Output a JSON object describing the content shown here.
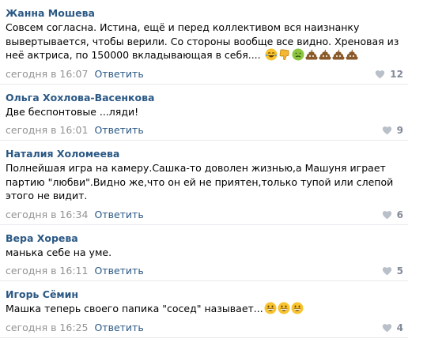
{
  "comments": [
    {
      "author": "Жанна Мошева",
      "text": "Совсем согласна. Истина, ещё и перед коллективом вся наизнанку вывертывается, чтобы верили. Со стороны вообще все видно. Хреновая из неё актриса, по 150000 вкладывающая в себя....",
      "emojis": [
        "laughing-tears-emoji",
        "thumbs-down-emoji",
        "nauseated-face-emoji",
        "poop-emoji",
        "poop-emoji",
        "poop-emoji",
        "poop-emoji"
      ],
      "time": "сегодня в 16:07",
      "reply": "Ответить",
      "likes": "12"
    },
    {
      "author": "Ольга Хохлова-Васенкова",
      "text": "Две беспонтовые ...ляди!",
      "time": "сегодня в 16:01",
      "reply": "Ответить",
      "likes": "9"
    },
    {
      "author": "Наталия Холомеева",
      "text": "Полнейшая игра на камеру.Сашка-то доволен жизнью,а Машуня играет партию \"любви\".Видно же,что он ей не приятен,только тупой или слепой этого не видит.",
      "time": "сегодня в 16:34",
      "reply": "Ответить",
      "likes": "6"
    },
    {
      "author": "Вера Хорева",
      "text": "манька себе на уме.",
      "time": "сегодня в 16:11",
      "reply": "Ответить",
      "likes": "5"
    },
    {
      "author": "Игорь Сёмин",
      "text": "Машка теперь своего папика \"сосед\" называет...",
      "emojis": [
        "grinning-face-emoji",
        "grinning-face-emoji",
        "grinning-face-emoji"
      ],
      "time": "сегодня в 16:25",
      "reply": "Ответить",
      "likes": "4"
    }
  ],
  "colors": {
    "author": "#2a5885",
    "link": "#2a5885",
    "time": "#939393",
    "likes": "#828a99",
    "divider": "#e7e8ec"
  }
}
